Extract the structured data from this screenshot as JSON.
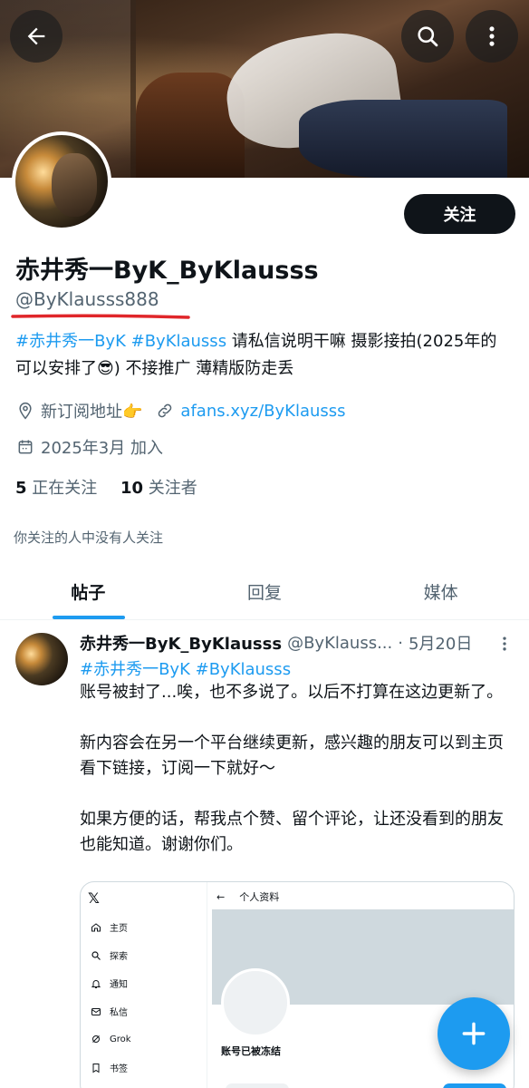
{
  "profile": {
    "name": "赤井秀一ByK_ByKlausss",
    "handle": "@ByKlausss888",
    "follow_label": "关注",
    "bio_tags": "#赤井秀一ByK #ByKlausss",
    "bio_text_1": " 请私信说明干嘛    摄影接拍(2025年的可以安排了",
    "bio_emoji": "😎",
    "bio_text_2": ") 不接推广                  薄精版防走丢",
    "location": "新订阅地址👉",
    "website": "afans.xyz/ByKlausss",
    "joined": "2025年3月 加入",
    "following_count": "5",
    "following_label": "正在关注",
    "followers_count": "10",
    "followers_label": "关注者",
    "followers_note": "你关注的人中没有人关注"
  },
  "tabs": [
    {
      "label": "帖子",
      "active": true
    },
    {
      "label": "回复",
      "active": false
    },
    {
      "label": "媒体",
      "active": false
    }
  ],
  "post": {
    "author_name": "赤井秀一ByK_ByKlausss",
    "author_handle": "@ByKlauss...",
    "separator": "·",
    "date": "5月20日",
    "tags": "#赤井秀一ByK #ByKlausss",
    "text": "账号被封了...唉，也不多说了。以后不打算在这边更新了。\n\n新内容会在另一个平台继续更新，感兴趣的朋友可以到主页看下链接，订阅一下就好～\n\n如果方便的话，帮我点个赞、留个评论，让还没看到的朋友也能知道。谢谢你们。"
  },
  "embed": {
    "logo": "𝕏",
    "nav": [
      "主页",
      "探索",
      "通知",
      "私信",
      "Grok",
      "书签"
    ],
    "top_back": "←",
    "top_title": "个人资料",
    "frozen_label": "账号已被冻结"
  },
  "colors": {
    "accent": "#1d9bf0",
    "text": "#0f1419",
    "secondary": "#536471",
    "underline": "#e0262a"
  },
  "icons": {
    "back": "back-arrow-icon",
    "search": "search-icon",
    "more": "more-vertical-icon",
    "location": "location-pin-icon",
    "link": "link-icon",
    "calendar": "calendar-icon",
    "compose": "plus-icon"
  }
}
